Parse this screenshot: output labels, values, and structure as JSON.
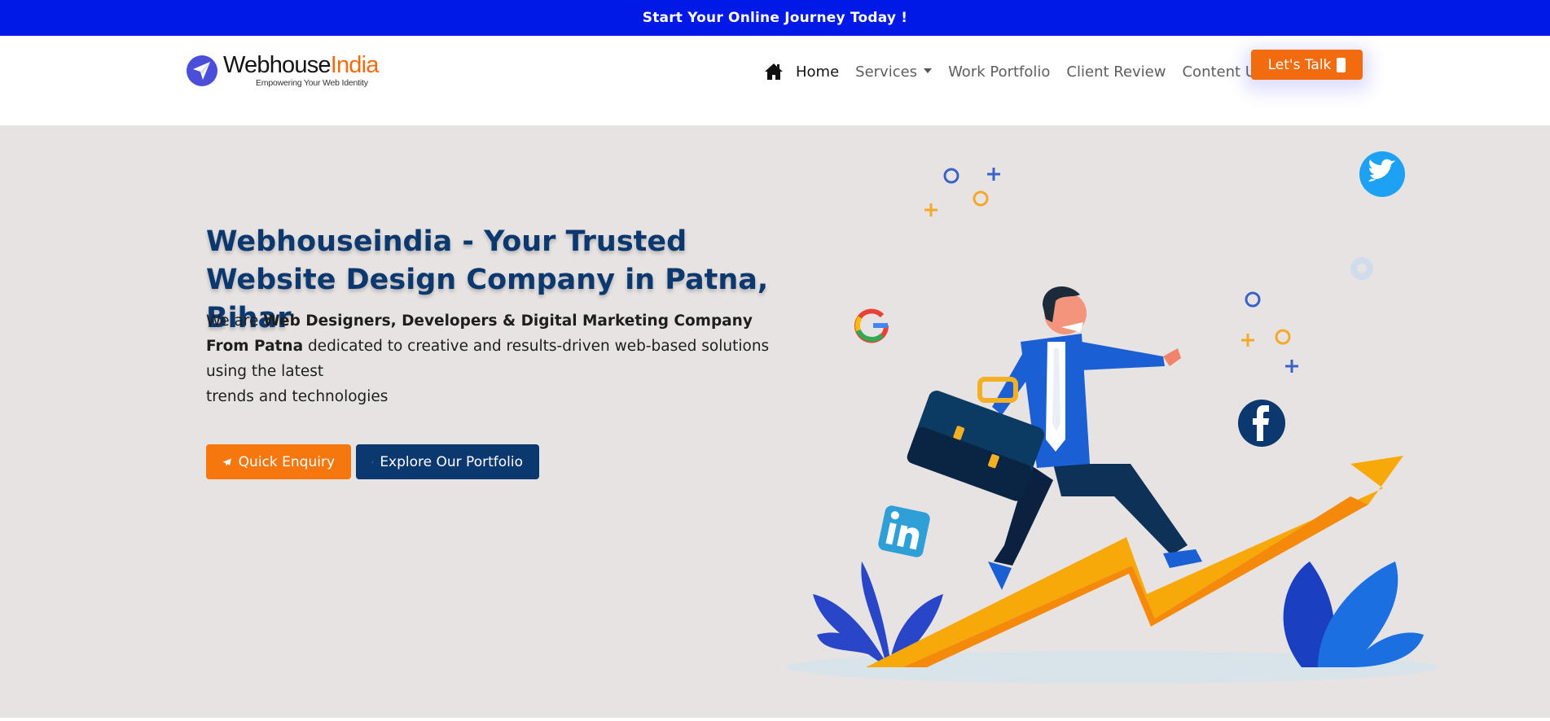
{
  "topbar": {
    "text": "Start Your Online Journey Today !"
  },
  "logo": {
    "name_part1": "Webhouse",
    "name_part2": "India",
    "tagline": "Empowering Your Web Identity",
    "icon": "paper-plane-logo-icon"
  },
  "nav": {
    "home_icon": "home-icon",
    "items": [
      {
        "label": "Home",
        "active": true
      },
      {
        "label": "Services",
        "dropdown": true
      },
      {
        "label": "Work Portfolio"
      },
      {
        "label": "Client Review"
      },
      {
        "label": "Content Us"
      }
    ],
    "cta": {
      "label": "Let's Talk",
      "icon": "phone-icon"
    }
  },
  "hero": {
    "title": "Webhouseindia - Your Trusted Website Design Company in Patna, Bihar",
    "desc_pre": "We are ",
    "desc_bold": "Web Designers, Developers & Digital Marketing Company From Patna",
    "desc_post": " dedicated to creative and results-driven web-based solutions using the latest",
    "desc_line2": "trends and technologies",
    "buttons": {
      "enquiry": {
        "label": "Quick Enquiry",
        "icon": "paper-plane-icon"
      },
      "portfolio": {
        "label": "Explore Our Portfolio",
        "icon": "bolt-icon"
      }
    },
    "illustration": {
      "icons": [
        "google-icon",
        "twitter-icon",
        "facebook-icon",
        "linkedin-icon",
        "gear-icon"
      ]
    }
  },
  "colors": {
    "topbar": "#0119e6",
    "accent": "#f26b0f",
    "navy": "#0c3870",
    "hero_bg": "#e7e3e3"
  }
}
